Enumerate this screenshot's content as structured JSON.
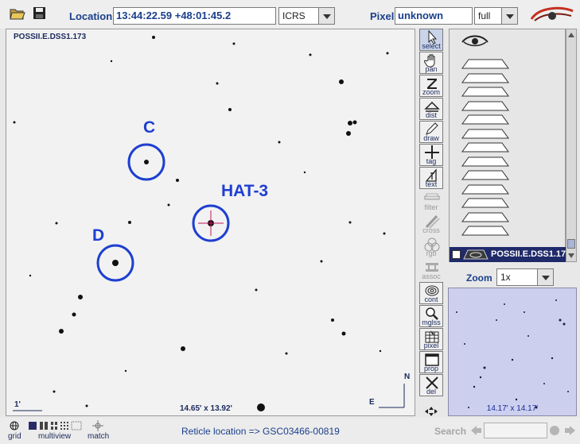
{
  "toolbar": {
    "location_label": "Location",
    "location_value": "13:44:22.59 +48:01:45.2",
    "frame_value": "ICRS",
    "pixel_label": "Pixel",
    "pixel_value": "unknown",
    "pixel_mode": "full"
  },
  "view": {
    "survey": "POSSII.E.DSS1.173",
    "fov": "14.65' x 13.92'",
    "scale": "1'",
    "compass_n": "N",
    "compass_e": "E",
    "targets": [
      {
        "label": "C"
      },
      {
        "label": "HAT-3"
      },
      {
        "label": "D"
      }
    ]
  },
  "tools": [
    {
      "label": "select",
      "icon": "arrow-cursor-icon"
    },
    {
      "label": "pan",
      "icon": "hand-icon"
    },
    {
      "label": "zoom",
      "icon": "zoom-z-icon"
    },
    {
      "label": "dist",
      "icon": "distance-icon"
    },
    {
      "label": "draw",
      "icon": "pencil-icon"
    },
    {
      "label": "tag",
      "icon": "crosshair-icon"
    },
    {
      "label": "text",
      "icon": "text-icon"
    },
    {
      "label": "filter",
      "icon": "filter-icon"
    },
    {
      "label": "cross",
      "icon": "cross-match-icon"
    },
    {
      "label": "rgb",
      "icon": "rgb-icon"
    },
    {
      "label": "assoc",
      "icon": "assoc-icon"
    },
    {
      "label": "cont",
      "icon": "contour-icon"
    },
    {
      "label": "mglss",
      "icon": "magnifier-icon"
    },
    {
      "label": "pixel",
      "icon": "pixel-table-icon"
    },
    {
      "label": "prop",
      "icon": "properties-icon"
    },
    {
      "label": "del",
      "icon": "delete-icon"
    }
  ],
  "stack": {
    "active_plane": "POSSII.E.DSS1.173"
  },
  "zoom": {
    "label": "Zoom",
    "value": "1x"
  },
  "thumbnail": {
    "fov": "14.17' x 14.17'"
  },
  "bottom": {
    "modes": [
      "grid",
      "multiview",
      "match"
    ],
    "status": "Reticle location => GSC03466-00819",
    "search_label": "Search"
  },
  "colors": {
    "accent": "#1a3f8c",
    "circle": "#1e3fd0",
    "selection": "#1f2a6a"
  }
}
